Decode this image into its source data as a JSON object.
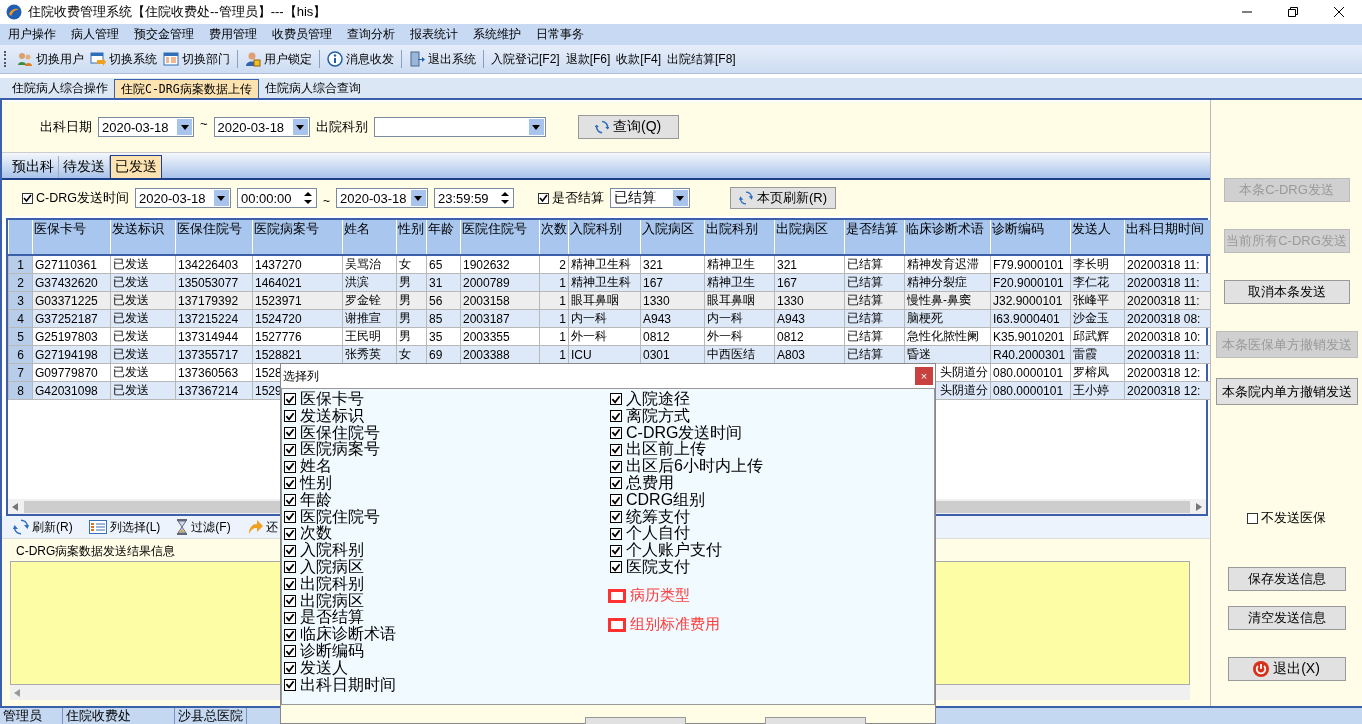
{
  "window": {
    "title": "住院收费管理系统【住院收费处--管理员】---【his】"
  },
  "menu": [
    "用户操作",
    "病人管理",
    "预交金管理",
    "费用管理",
    "收费员管理",
    "查询分析",
    "报表统计",
    "系统维护",
    "日常事务"
  ],
  "toolbar": [
    [
      {
        "label": "切换用户"
      },
      {
        "label": "切换系统"
      },
      {
        "label": "切换部门"
      }
    ],
    [
      {
        "label": "用户锁定"
      }
    ],
    [
      {
        "label": "消息收发"
      }
    ],
    [
      {
        "label": "退出系统"
      }
    ],
    [
      {
        "label": "入院登记[F2]"
      },
      {
        "label": "退款[F6]"
      },
      {
        "label": "收款[F4]"
      },
      {
        "label": "出院结算[F8]"
      }
    ]
  ],
  "page_tabs": [
    {
      "label": "住院病人综合操作",
      "selected": false
    },
    {
      "label": "住院C-DRG病案数据上传",
      "selected": true
    },
    {
      "label": "住院病人综合查询",
      "selected": false
    }
  ],
  "query": {
    "date_label": "出科日期",
    "date_from": "2020-03-18",
    "range_sep": "~",
    "date_to": "2020-03-18",
    "dept_label": "出院科别",
    "button": "查询(Q)"
  },
  "sub_tabs": [
    {
      "label": "预出科",
      "selected": false
    },
    {
      "label": "待发送",
      "selected": false
    },
    {
      "label": "已发送",
      "selected": true
    }
  ],
  "filter": {
    "send_time": {
      "label": "C-DRG发送时间",
      "checked": true
    },
    "date_from": "2020-03-18",
    "time_from": "00:00:00",
    "range_sep": "~",
    "date_to": "2020-03-18",
    "time_to": "23:59:59",
    "settled": {
      "label": "是否结算",
      "checked": true
    },
    "settled_value": "已结算",
    "refresh_button": "本页刷新(R)"
  },
  "table": {
    "columns": [
      "医保卡号",
      "发送标识",
      "医保住院号",
      "医院病案号",
      "姓名",
      "性别",
      "年龄",
      "医院住院号",
      "次数",
      "入院科别",
      "入院病区",
      "出院科别",
      "出院病区",
      "是否结算",
      "临床诊断术语",
      "诊断编码",
      "发送人",
      "出科日期时间"
    ],
    "rows": [
      {
        "number": "1",
        "selected": false,
        "cells": [
          "G27110361",
          "已发送",
          "134226403",
          "1437270",
          "吴骂治",
          "女",
          "65",
          "1902632",
          "2",
          "精神卫生科",
          "321",
          "精神卫生",
          "321",
          "已结算",
          "精神发育迟滞",
          "F79.9000101",
          "李长明",
          "20200318 11:"
        ]
      },
      {
        "number": "2",
        "selected": false,
        "cells": [
          "G37432620",
          "已发送",
          "135053077",
          "1464021",
          "洪滨",
          "男",
          "31",
          "2000789",
          "1",
          "精神卫生科",
          "167",
          "精神卫生",
          "167",
          "已结算",
          "精神分裂症",
          "F20.9000101",
          "李仁花",
          "20200318 11:"
        ]
      },
      {
        "number": "3",
        "selected": true,
        "cells": [
          "G03371225",
          "已发送",
          "137179392",
          "1523971",
          "罗金铨",
          "男",
          "56",
          "2003158",
          "1",
          "眼耳鼻咽",
          "1330",
          "眼耳鼻咽",
          "1330",
          "已结算",
          "慢性鼻-鼻窦",
          "J32.9000101",
          "张峰平",
          "20200318 11:"
        ]
      },
      {
        "number": "4",
        "selected": false,
        "cells": [
          "G37252187",
          "已发送",
          "137215224",
          "1524720",
          "谢推宣",
          "男",
          "85",
          "2003187",
          "1",
          "内一科",
          "A943",
          "内一科",
          "A943",
          "已结算",
          "脑梗死",
          "I63.9000401",
          "沙金玉",
          "20200318 08:"
        ]
      },
      {
        "number": "5",
        "selected": false,
        "cells": [
          "G25197803",
          "已发送",
          "137314944",
          "1527776",
          "王民明",
          "男",
          "35",
          "2003355",
          "1",
          "外一科",
          "0812",
          "外一科",
          "0812",
          "已结算",
          "急性化脓性阑",
          "K35.9010201",
          "邱武辉",
          "20200318 10:"
        ]
      },
      {
        "number": "6",
        "selected": false,
        "cells": [
          "G27194198",
          "已发送",
          "137355717",
          "1528821",
          "张秀英",
          "女",
          "69",
          "2003388",
          "1",
          "ICU",
          "0301",
          "中西医结",
          "A803",
          "已结算",
          "昏迷",
          "R40.2000301",
          "雷霞",
          "20200318 11:"
        ]
      },
      {
        "number": "7",
        "selected": false,
        "cells": [
          "G09779870",
          "已发送",
          "137360563",
          "1528",
          null,
          null,
          null,
          null,
          null,
          null,
          null,
          null,
          null,
          null,
          "头阴道分",
          "080.0000101",
          "罗榕凤",
          "20200318 12:"
        ]
      },
      {
        "number": "8",
        "selected": false,
        "cells": [
          "G42031098",
          "已发送",
          "137367214",
          "1529",
          null,
          null,
          null,
          null,
          null,
          null,
          null,
          null,
          null,
          null,
          "头阴道分",
          "080.0000101",
          "王小婷",
          "20200318 12:"
        ]
      }
    ]
  },
  "bottom_toolbar": [
    {
      "label": "刷新(R)"
    },
    {
      "label": "列选择(L)"
    },
    {
      "label": "过滤(F)"
    },
    {
      "label": "还"
    }
  ],
  "result_box": {
    "title": "C-DRG病案数据发送结果信息"
  },
  "side_controls": [
    {
      "kind": "button",
      "label": "本条C-DRG发送",
      "disabled": true
    },
    {
      "kind": "button",
      "label": "当前所有C-DRG发送",
      "disabled": true
    },
    {
      "kind": "button",
      "label": "取消本条发送",
      "disabled": false
    },
    {
      "kind": "button",
      "label": "本条医保单方撤销发送",
      "disabled": true
    },
    {
      "kind": "button",
      "label": "本条院内单方撤销发送",
      "disabled": false
    },
    {
      "kind": "checkbox",
      "label": "不发送医保",
      "checked": false
    },
    {
      "kind": "button",
      "label": "保存发送信息",
      "disabled": false
    },
    {
      "kind": "button",
      "label": "清空发送信息",
      "disabled": false
    },
    {
      "kind": "exit",
      "label": "退出(X)",
      "disabled": false
    }
  ],
  "status_bar": [
    "管理员",
    "住院收费处",
    "沙县总医院"
  ],
  "dialog": {
    "title": "选择列",
    "close": "×",
    "left_column": [
      {
        "label": "医保卡号",
        "checked": true
      },
      {
        "label": "发送标识",
        "checked": true
      },
      {
        "label": "医保住院号",
        "checked": true
      },
      {
        "label": "医院病案号",
        "checked": true
      },
      {
        "label": "姓名",
        "checked": true
      },
      {
        "label": "性别",
        "checked": true
      },
      {
        "label": "年龄",
        "checked": true
      },
      {
        "label": "医院住院号",
        "checked": true
      },
      {
        "label": "次数",
        "checked": true
      },
      {
        "label": "入院科别",
        "checked": true
      },
      {
        "label": "入院病区",
        "checked": true
      },
      {
        "label": "出院科别",
        "checked": true
      },
      {
        "label": "出院病区",
        "checked": true
      },
      {
        "label": "是否结算",
        "checked": true
      },
      {
        "label": "临床诊断术语",
        "checked": true
      },
      {
        "label": "诊断编码",
        "checked": true
      },
      {
        "label": "发送人",
        "checked": true
      },
      {
        "label": "出科日期时间",
        "checked": true
      }
    ],
    "right_column": [
      {
        "label": "入院途径",
        "checked": true
      },
      {
        "label": "离院方式",
        "checked": true
      },
      {
        "label": "C-DRG发送时间",
        "checked": true
      },
      {
        "label": "出区前上传",
        "checked": true
      },
      {
        "label": "出区后6小时内上传",
        "checked": true
      },
      {
        "label": "总费用",
        "checked": true
      },
      {
        "label": "CDRG组别",
        "checked": true
      },
      {
        "label": "统筹支付",
        "checked": true
      },
      {
        "label": "个人自付",
        "checked": true
      },
      {
        "label": "个人账户支付",
        "checked": true
      },
      {
        "label": "医院支付",
        "checked": true
      },
      {
        "label": "病历类型",
        "checked": false
      },
      {
        "label": "组别标准费用",
        "checked": false
      }
    ]
  }
}
